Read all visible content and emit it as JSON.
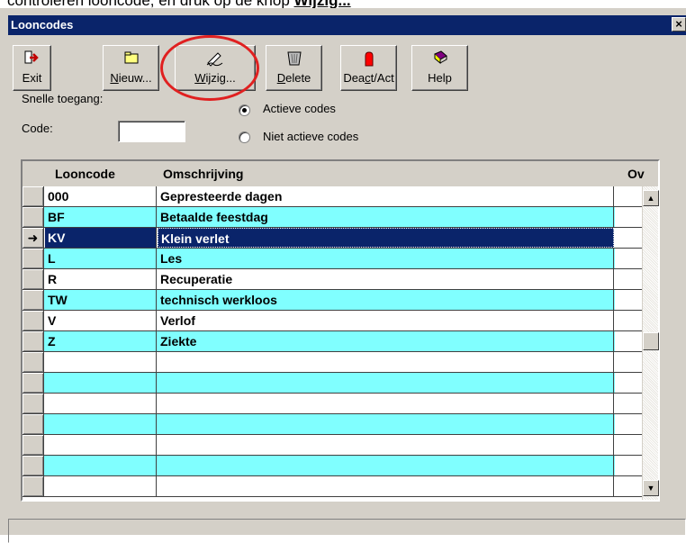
{
  "doc_instruction": {
    "text": "controleren looncode, en druk op de knop ",
    "emphasis": "Wijzig..."
  },
  "window": {
    "title": "Looncodes",
    "close_glyph": "×"
  },
  "toolbar": {
    "buttons": [
      {
        "label": "Exit",
        "underline": "",
        "icon": "exit-arrow-icon"
      },
      {
        "label": "ieuw...",
        "underline": "N",
        "icon": "new-folder-icon"
      },
      {
        "label": "ijzig...",
        "underline": "W",
        "icon": "edit-pen-icon"
      },
      {
        "label": "elete",
        "underline": "D",
        "icon": "trash-bin-icon"
      },
      {
        "label": "Dea",
        "underline": "c",
        "rest": "t/Act",
        "icon": "hand-stop-icon"
      },
      {
        "label": "Help",
        "underline": "",
        "icon": "help-book-icon"
      }
    ]
  },
  "filter": {
    "quick_access_label": "Snelle toegang:",
    "code_label": "Code:",
    "code_value": "",
    "radio_active": "Actieve codes",
    "radio_inactive": "Niet actieve codes",
    "selected_radio": "active"
  },
  "grid": {
    "columns": [
      "Looncode",
      "Omschrijving",
      "Ov"
    ],
    "rows": [
      {
        "code": "000",
        "description": "Gepresteerde dagen",
        "ov": ""
      },
      {
        "code": "BF",
        "description": "Betaalde feestdag",
        "ov": ""
      },
      {
        "code": "KV",
        "description": "Klein verlet",
        "ov": ""
      },
      {
        "code": "L",
        "description": "Les",
        "ov": ""
      },
      {
        "code": "R",
        "description": "Recuperatie",
        "ov": ""
      },
      {
        "code": "TW",
        "description": "technisch werkloos",
        "ov": ""
      },
      {
        "code": "V",
        "description": "Verlof",
        "ov": ""
      },
      {
        "code": "Z",
        "description": "Ziekte",
        "ov": ""
      },
      {
        "code": "",
        "description": "",
        "ov": ""
      },
      {
        "code": "",
        "description": "",
        "ov": ""
      },
      {
        "code": "",
        "description": "",
        "ov": ""
      },
      {
        "code": "",
        "description": "",
        "ov": ""
      },
      {
        "code": "",
        "description": "",
        "ov": ""
      },
      {
        "code": "",
        "description": "",
        "ov": ""
      },
      {
        "code": "",
        "description": "",
        "ov": ""
      }
    ],
    "selected_index": 2,
    "row_pointer_glyph": "➜",
    "colors": {
      "cyan": "#80ffff",
      "white": "#ffffff",
      "selected": "#0a246a",
      "highlight_circle": "#e02020"
    }
  }
}
